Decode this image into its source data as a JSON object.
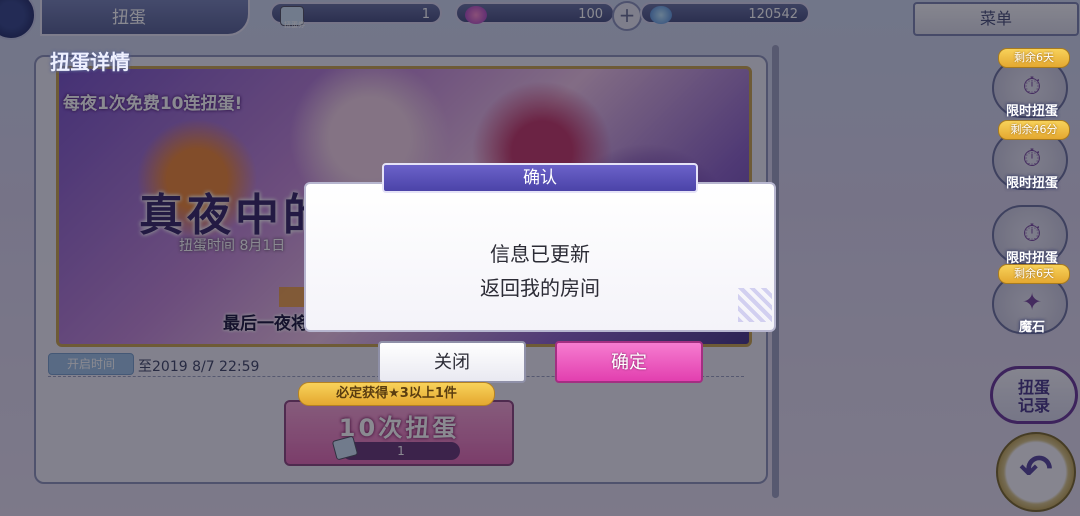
{
  "header": {
    "title": "扭蛋",
    "resources": [
      {
        "icon": "gacha-ticket-icon",
        "label": "扭蛋券",
        "value": "1"
      },
      {
        "icon": "crystal-icon",
        "value": "100"
      },
      {
        "icon": "potion-icon",
        "value": "120542"
      }
    ],
    "menu_label": "菜单"
  },
  "panel": {
    "title": "扭蛋详情",
    "banner": {
      "subtitle": "每夜1次免费10连扭蛋!",
      "headline": "真夜中的免费十连扭蛋",
      "period": "扭蛋时间 8月1日",
      "last_note": "最后一夜将会变为"
    },
    "open_time_label": "开启时间",
    "open_time_value": "至2019 8/7 22:59",
    "gacha": {
      "guarantee_text": "必定获得★3以上1件",
      "button_label": "10次扭蛋",
      "cost_icon": "gacha-ticket-icon",
      "cost_value": "1"
    }
  },
  "sidebar": {
    "items": [
      {
        "badge": "剩余6天",
        "label": "限时扭蛋",
        "icon": "clock-icon"
      },
      {
        "badge": "剩余46分",
        "label": "限时扭蛋",
        "icon": "clock-icon"
      },
      {
        "badge": "",
        "label": "限时扭蛋",
        "icon": "clock-icon"
      },
      {
        "badge": "剩余6天",
        "label": "魔石",
        "icon": "star-icon"
      }
    ],
    "history_label_line1": "扭蛋",
    "history_label_line2": "记录",
    "back_icon": "back-arrow-icon"
  },
  "dialog": {
    "title": "确认",
    "message_line1": "信息已更新",
    "message_line2": "返回我的房间",
    "close_label": "关闭",
    "ok_label": "确定"
  },
  "colors": {
    "accent_purple": "#4b43a8",
    "ok_pink": "#e23faf",
    "badge_gold": "#e4a830"
  }
}
